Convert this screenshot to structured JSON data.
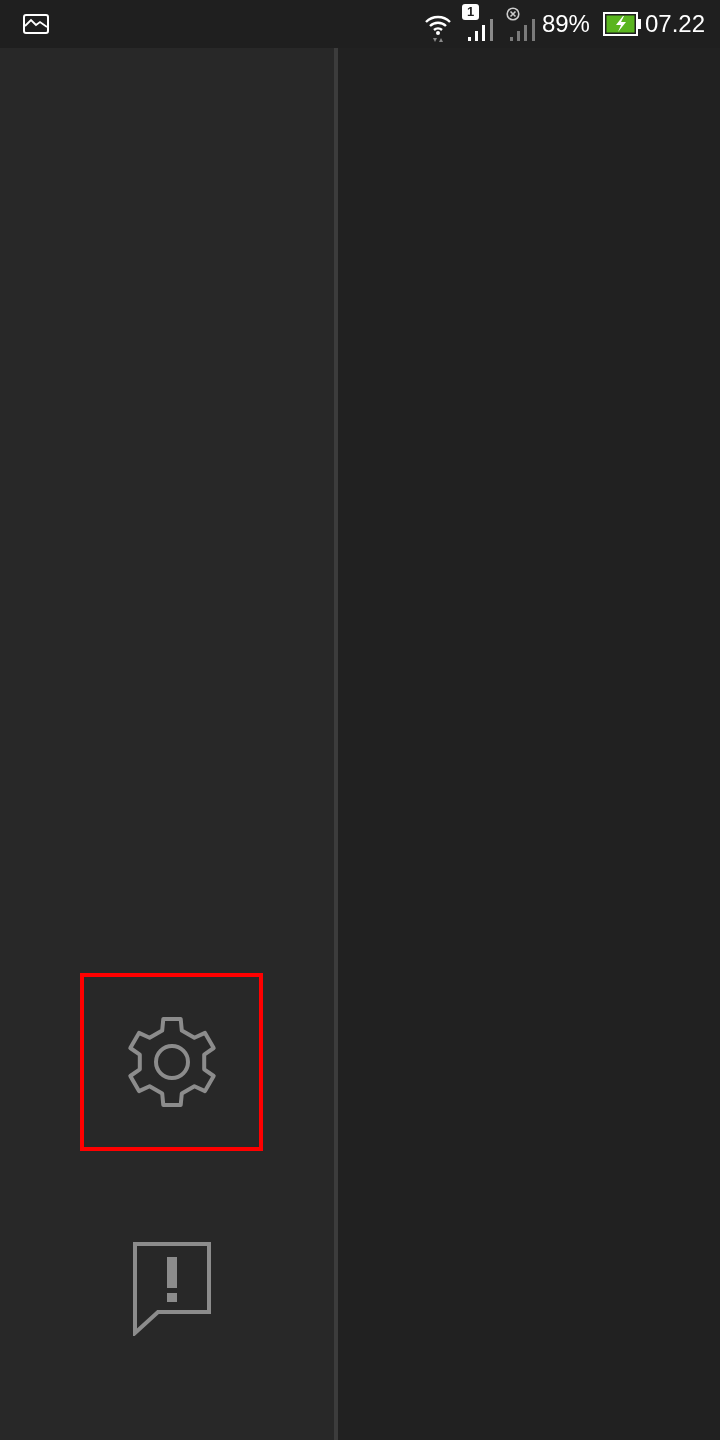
{
  "status_bar": {
    "sim_badge": "1",
    "battery_text": "89%",
    "charging": true,
    "time": "07.22"
  },
  "sidebar": {
    "items": [
      {
        "kind": "settings",
        "highlighted": true
      },
      {
        "kind": "feedback",
        "highlighted": false
      }
    ]
  }
}
